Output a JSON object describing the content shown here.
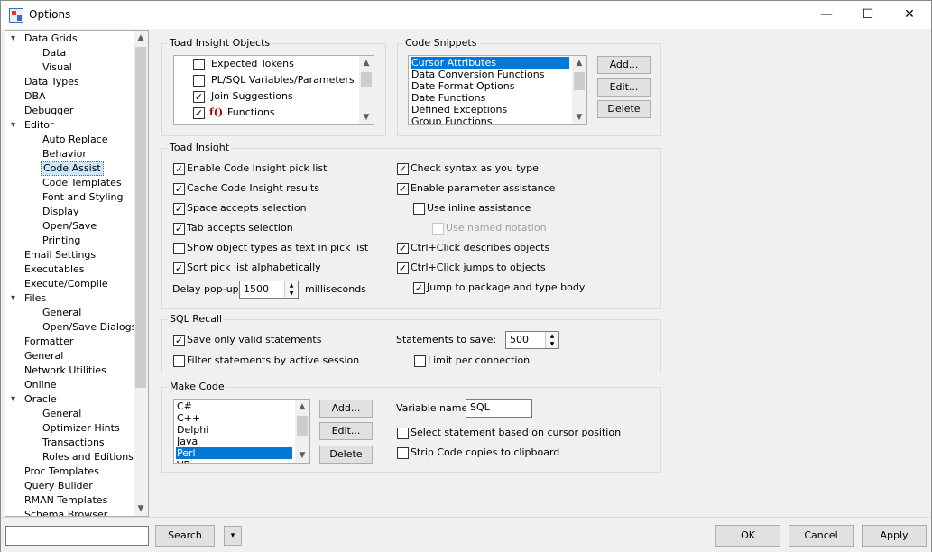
{
  "window": {
    "title": "Options",
    "minimize": "—",
    "maximize": "☐",
    "close": "✕"
  },
  "tree": {
    "items": [
      {
        "label": "Data Grids",
        "expander": "▾"
      },
      {
        "label": "Data"
      },
      {
        "label": "Visual"
      },
      {
        "label": "Data Types"
      },
      {
        "label": "DBA"
      },
      {
        "label": "Debugger"
      },
      {
        "label": "Editor",
        "expander": "▾"
      },
      {
        "label": "Auto Replace"
      },
      {
        "label": "Behavior"
      },
      {
        "label": "Code Assist"
      },
      {
        "label": "Code Templates"
      },
      {
        "label": "Font and Styling"
      },
      {
        "label": "Display"
      },
      {
        "label": "Open/Save"
      },
      {
        "label": "Printing"
      },
      {
        "label": "Email Settings"
      },
      {
        "label": "Executables"
      },
      {
        "label": "Execute/Compile"
      },
      {
        "label": "Files",
        "expander": "▾"
      },
      {
        "label": "General"
      },
      {
        "label": "Open/Save Dialogs"
      },
      {
        "label": "Formatter"
      },
      {
        "label": "General"
      },
      {
        "label": "Network Utilities"
      },
      {
        "label": "Online"
      },
      {
        "label": "Oracle",
        "expander": "▾"
      },
      {
        "label": "General"
      },
      {
        "label": "Optimizer Hints"
      },
      {
        "label": "Transactions"
      },
      {
        "label": "Roles and Editions"
      },
      {
        "label": "Proc Templates"
      },
      {
        "label": "Query Builder"
      },
      {
        "label": "RMAN Templates"
      },
      {
        "label": "Schema Browser"
      }
    ]
  },
  "toad_insight_objects": {
    "title": "Toad Insight Objects",
    "items": [
      {
        "label": "Expected Tokens",
        "check": ""
      },
      {
        "label": "PL/SQL Variables/Parameters",
        "check": ""
      },
      {
        "label": "Join Suggestions",
        "check": "✓"
      },
      {
        "label": "Functions",
        "check": "✓",
        "icon": "f()"
      },
      {
        "label": "",
        "check": "✓",
        "icon": "f()"
      }
    ]
  },
  "code_snippets": {
    "title": "Code Snippets",
    "items": [
      "Cursor Attributes",
      "Data Conversion Functions",
      "Date Format Options",
      "Date Functions",
      "Defined Exceptions",
      "Group Functions"
    ],
    "add": "Add...",
    "edit": "Edit...",
    "delete": "Delete"
  },
  "toad_insight": {
    "title": "Toad Insight",
    "left": [
      {
        "label": "Enable Code Insight pick list",
        "check": "✓"
      },
      {
        "label": "Cache Code Insight results",
        "check": "✓"
      },
      {
        "label": "Space accepts selection",
        "check": "✓"
      },
      {
        "label": "Tab accepts selection",
        "check": "✓"
      },
      {
        "label": "Show object types as text in pick list",
        "check": ""
      },
      {
        "label": "Sort pick list alphabetically",
        "check": "✓"
      }
    ],
    "right": [
      {
        "label": "Check syntax as you type",
        "check": "✓"
      },
      {
        "label": "Enable parameter assistance",
        "check": "✓"
      },
      {
        "label": "Use inline assistance",
        "check": ""
      },
      {
        "label": "Use named notation",
        "check": ""
      },
      {
        "label": "Ctrl+Click describes objects",
        "check": "✓"
      },
      {
        "label": "Ctrl+Click jumps to objects",
        "check": "✓"
      },
      {
        "label": "Jump to package and type body",
        "check": "✓"
      }
    ],
    "delay_label": "Delay pop-ups",
    "delay_value": "1500",
    "delay_unit": "milliseconds"
  },
  "sql_recall": {
    "title": "SQL Recall",
    "save_valid": {
      "label": "Save only valid statements",
      "check": "✓"
    },
    "filter_session": {
      "label": "Filter statements by active session",
      "check": ""
    },
    "statements_label": "Statements to save:",
    "statements_value": "500",
    "limit_conn": {
      "label": "Limit per connection",
      "check": ""
    }
  },
  "make_code": {
    "title": "Make Code",
    "languages": [
      "C#",
      "C++",
      "Delphi",
      "Java",
      "Perl",
      "VB"
    ],
    "add": "Add...",
    "edit": "Edit...",
    "delete": "Delete",
    "variable_label": "Variable name:",
    "variable_value": "SQL",
    "select_stmt": {
      "label": "Select statement based on cursor position",
      "check": ""
    },
    "strip_code": {
      "label": "Strip Code copies to clipboard",
      "check": ""
    }
  },
  "footer": {
    "search_placeholder": "",
    "search": "Search",
    "dropdown": "▾",
    "ok": "OK",
    "cancel": "Cancel",
    "apply": "Apply"
  }
}
